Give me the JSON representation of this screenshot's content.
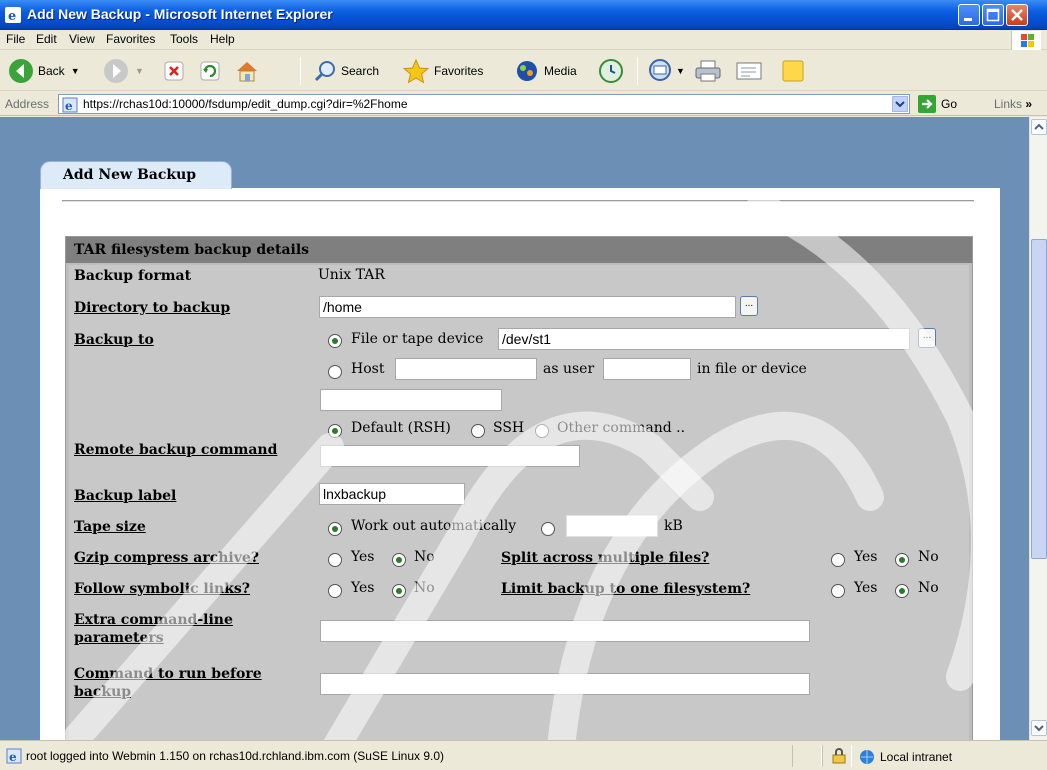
{
  "window": {
    "title": "Add New Backup - Microsoft Internet Explorer"
  },
  "menu": [
    "File",
    "Edit",
    "View",
    "Favorites",
    "Tools",
    "Help"
  ],
  "toolbar": {
    "back": "Back",
    "search": "Search",
    "favorites": "Favorites",
    "media": "Media"
  },
  "address": {
    "label": "Address",
    "url": "https://rchas10d:10000/fsdump/edit_dump.cgi?dir=%2Fhome",
    "go": "Go",
    "links": "Links"
  },
  "page": {
    "tab_title": "Add New Backup",
    "section_title": "TAR filesystem backup details",
    "form": {
      "backup_format_label": "Backup format",
      "backup_format_value": "Unix TAR",
      "directory_label": "Directory to backup",
      "directory_value": "/home",
      "backup_to_label": "Backup to",
      "file_option": "File or tape device",
      "file_value": "/dev/st1",
      "host_option": "Host",
      "as_user": "as user",
      "in_file_or_device": "in file or device",
      "remote_cmd_label": "Remote backup command",
      "remote_default": "Default (RSH)",
      "remote_ssh": "SSH",
      "remote_other": "Other command ..",
      "label_label": "Backup label",
      "label_value": "lnxbackup",
      "tape_size_label": "Tape size",
      "tape_auto": "Work out automatically",
      "tape_unit": "kB",
      "gzip_label": "Gzip compress archive?",
      "split_label": "Split across multiple files?",
      "symlinks_label": "Follow symbolic links?",
      "onefs_label": "Limit backup to one filesystem?",
      "yes": "Yes",
      "no": "No",
      "extra_label": "Extra command-line parameters",
      "before_label": "Command to run before backup"
    }
  },
  "status": {
    "text": "root logged into Webmin 1.150 on rchas10d.rchland.ibm.com (SuSE Linux 9.0)",
    "zone": "Local intranet"
  }
}
